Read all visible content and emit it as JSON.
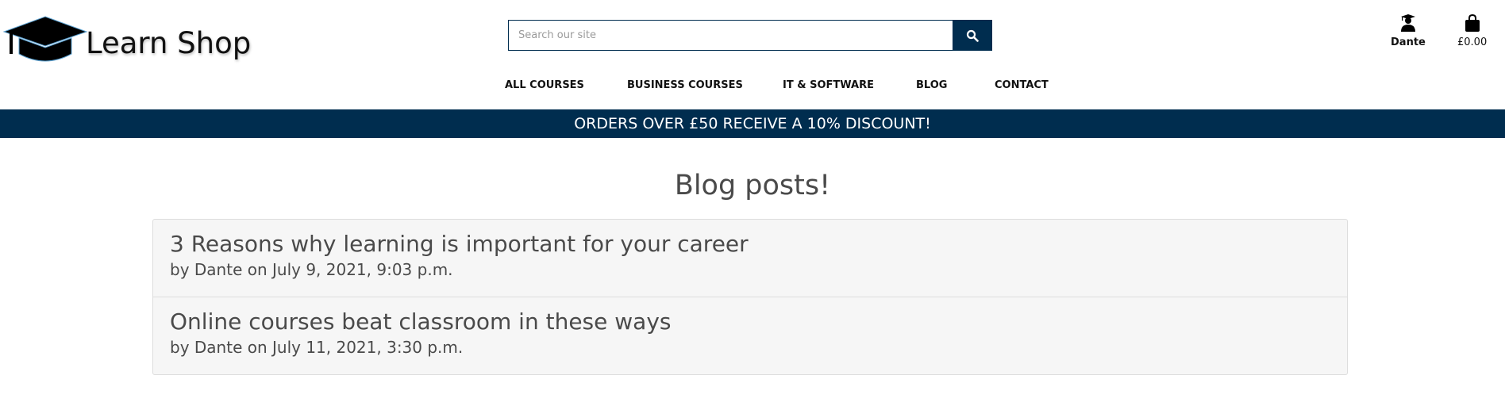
{
  "logo": {
    "text": "Learn Shop"
  },
  "search": {
    "placeholder": "Search our site",
    "icon": "search-icon"
  },
  "nav": [
    "ALL COURSES",
    "BUSINESS COURSES",
    "IT & SOFTWARE",
    "BLOG",
    "CONTACT"
  ],
  "account": {
    "label": "Dante",
    "icon": "user-graduate-icon"
  },
  "cart": {
    "total": "£0.00",
    "icon": "shopping-bag-icon"
  },
  "banner": "ORDERS OVER £50 RECEIVE A 10% DISCOUNT!",
  "page_title": "Blog posts!",
  "posts": [
    {
      "title": "3 Reasons why learning is important for your career",
      "meta": "by Dante on July 9, 2021, 9:03 p.m."
    },
    {
      "title": "Online courses beat classroom in these ways",
      "meta": "by Dante on July 11, 2021, 3:30 p.m."
    }
  ],
  "colors": {
    "brand": "#002d4f"
  }
}
